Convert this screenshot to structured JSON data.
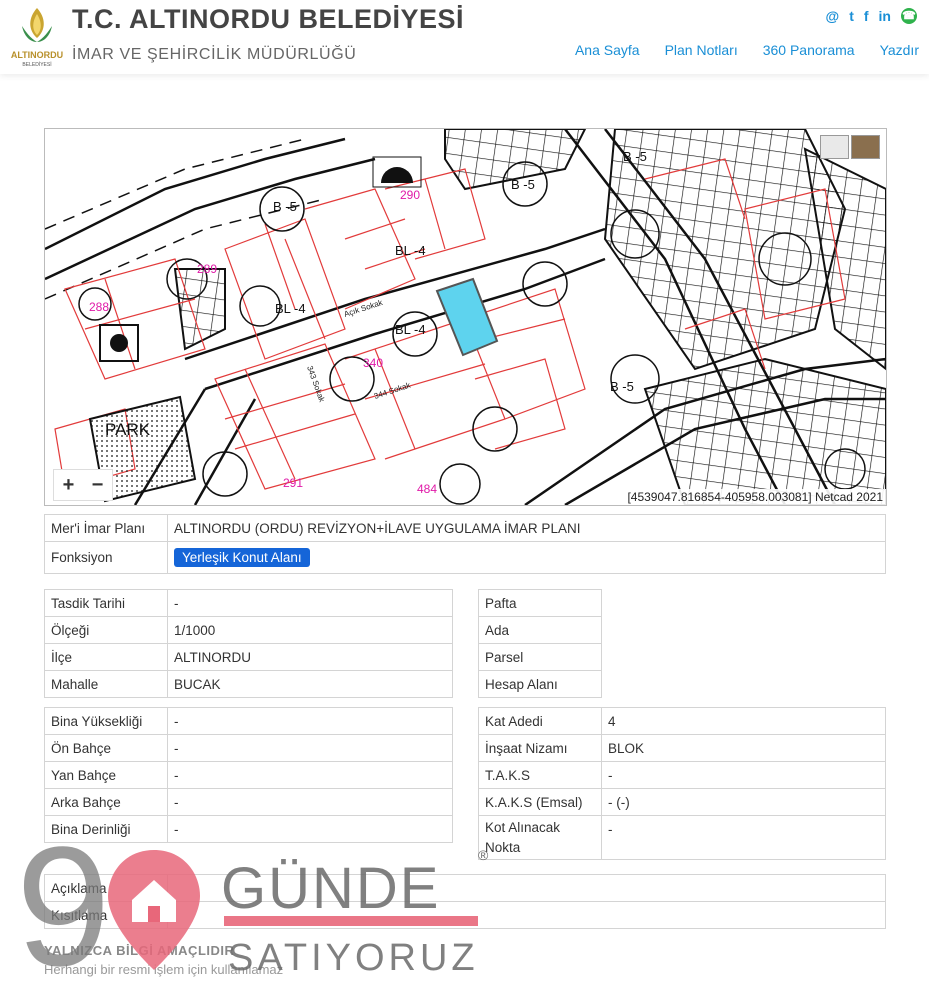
{
  "header": {
    "logo_text_top": "ALTINORDU",
    "logo_text_bottom": "BELEDİYESİ",
    "title": "T.C. ALTINORDU BELEDİYESİ",
    "subtitle": "İMAR VE ŞEHİRCİLİK MÜDÜRLÜĞÜ",
    "social": [
      {
        "name": "at-icon",
        "glyph": "@"
      },
      {
        "name": "twitter-icon",
        "glyph": "t"
      },
      {
        "name": "facebook-icon",
        "glyph": "f"
      },
      {
        "name": "linkedin-icon",
        "glyph": "in"
      }
    ],
    "nav": [
      "Ana Sayfa",
      "Plan Notları",
      "360 Panorama",
      "Yazdır"
    ]
  },
  "map": {
    "zoom_in": "+",
    "zoom_out": "−",
    "coords": "[4539047.816854-405958.003081] Netcad 2021",
    "labels": {
      "park": "PARK",
      "bl4a": "BL -4",
      "bl4b": "BL -4",
      "bl4c": "BL -4",
      "b5a": "B -5",
      "b5b": "B -5",
      "b5c": "B -5",
      "b5d": "B -5",
      "n290": "290",
      "n289": "289",
      "n288": "288",
      "n340": "340",
      "n291": "291",
      "n484": "484",
      "street1": "Açık Sokak",
      "street2": "343 Sokak",
      "street3": "344 Sokak"
    }
  },
  "plan": {
    "rows": [
      {
        "k": "Mer'i İmar Planı",
        "v": "ALTINORDU (ORDU) REVİZYON+İLAVE UYGULAMA İMAR PLANI"
      },
      {
        "k": "Fonksiyon",
        "v": "Yerleşik Konut Alanı"
      }
    ]
  },
  "left1": [
    {
      "k": "Tasdik Tarihi",
      "v": "-"
    },
    {
      "k": "Ölçeği",
      "v": "1/1000"
    },
    {
      "k": "İlçe",
      "v": "ALTINORDU"
    },
    {
      "k": "Mahalle",
      "v": "BUCAK"
    }
  ],
  "right1": [
    {
      "k": "Pafta",
      "v": ""
    },
    {
      "k": "Ada",
      "v": ""
    },
    {
      "k": "Parsel",
      "v": ""
    },
    {
      "k": "Hesap Alanı",
      "v": ""
    }
  ],
  "left2": [
    {
      "k": "Bina Yüksekliği",
      "v": "-"
    },
    {
      "k": "Ön Bahçe",
      "v": "-"
    },
    {
      "k": "Yan Bahçe",
      "v": "-"
    },
    {
      "k": "Arka Bahçe",
      "v": "-"
    },
    {
      "k": "Bina Derinliği",
      "v": "-"
    }
  ],
  "right2": [
    {
      "k": "Kat Adedi",
      "v": "4"
    },
    {
      "k": "İnşaat Nizamı",
      "v": "BLOK"
    },
    {
      "k": "T.A.K.S",
      "v": "-"
    },
    {
      "k": "K.A.K.S (Emsal)",
      "v": "- (-)"
    },
    {
      "k": "Kot Alınacak Nokta",
      "v": "-"
    }
  ],
  "notes": [
    {
      "k": "Açıklama",
      "v": ""
    },
    {
      "k": "Kısıtlama",
      "v": ""
    }
  ],
  "footer": {
    "line1": "YALNIZCA BİLGİ AMAÇLIDIR",
    "line2": "Herhangi bir resmi işlem için kullanılamaz"
  },
  "watermark": {
    "number": "9",
    "word1": "GÜNDE",
    "word2": "SATIYORUZ",
    "reg": "®"
  },
  "colors": {
    "accent": "#1a8fd6",
    "badge": "#1565d8",
    "parcel": "#5ed3ee",
    "plan_line": "#e23b3b",
    "watermark_red": "#e8677a"
  }
}
